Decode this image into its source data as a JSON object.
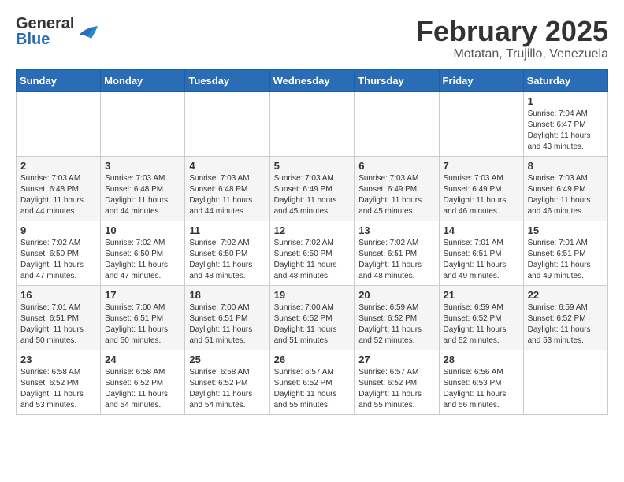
{
  "header": {
    "logo_general": "General",
    "logo_blue": "Blue",
    "month_title": "February 2025",
    "location": "Motatan, Trujillo, Venezuela"
  },
  "weekdays": [
    "Sunday",
    "Monday",
    "Tuesday",
    "Wednesday",
    "Thursday",
    "Friday",
    "Saturday"
  ],
  "weeks": [
    [
      {
        "day": "",
        "info": ""
      },
      {
        "day": "",
        "info": ""
      },
      {
        "day": "",
        "info": ""
      },
      {
        "day": "",
        "info": ""
      },
      {
        "day": "",
        "info": ""
      },
      {
        "day": "",
        "info": ""
      },
      {
        "day": "1",
        "info": "Sunrise: 7:04 AM\nSunset: 6:47 PM\nDaylight: 11 hours and 43 minutes."
      }
    ],
    [
      {
        "day": "2",
        "info": "Sunrise: 7:03 AM\nSunset: 6:48 PM\nDaylight: 11 hours and 44 minutes."
      },
      {
        "day": "3",
        "info": "Sunrise: 7:03 AM\nSunset: 6:48 PM\nDaylight: 11 hours and 44 minutes."
      },
      {
        "day": "4",
        "info": "Sunrise: 7:03 AM\nSunset: 6:48 PM\nDaylight: 11 hours and 44 minutes."
      },
      {
        "day": "5",
        "info": "Sunrise: 7:03 AM\nSunset: 6:49 PM\nDaylight: 11 hours and 45 minutes."
      },
      {
        "day": "6",
        "info": "Sunrise: 7:03 AM\nSunset: 6:49 PM\nDaylight: 11 hours and 45 minutes."
      },
      {
        "day": "7",
        "info": "Sunrise: 7:03 AM\nSunset: 6:49 PM\nDaylight: 11 hours and 46 minutes."
      },
      {
        "day": "8",
        "info": "Sunrise: 7:03 AM\nSunset: 6:49 PM\nDaylight: 11 hours and 46 minutes."
      }
    ],
    [
      {
        "day": "9",
        "info": "Sunrise: 7:02 AM\nSunset: 6:50 PM\nDaylight: 11 hours and 47 minutes."
      },
      {
        "day": "10",
        "info": "Sunrise: 7:02 AM\nSunset: 6:50 PM\nDaylight: 11 hours and 47 minutes."
      },
      {
        "day": "11",
        "info": "Sunrise: 7:02 AM\nSunset: 6:50 PM\nDaylight: 11 hours and 48 minutes."
      },
      {
        "day": "12",
        "info": "Sunrise: 7:02 AM\nSunset: 6:50 PM\nDaylight: 11 hours and 48 minutes."
      },
      {
        "day": "13",
        "info": "Sunrise: 7:02 AM\nSunset: 6:51 PM\nDaylight: 11 hours and 48 minutes."
      },
      {
        "day": "14",
        "info": "Sunrise: 7:01 AM\nSunset: 6:51 PM\nDaylight: 11 hours and 49 minutes."
      },
      {
        "day": "15",
        "info": "Sunrise: 7:01 AM\nSunset: 6:51 PM\nDaylight: 11 hours and 49 minutes."
      }
    ],
    [
      {
        "day": "16",
        "info": "Sunrise: 7:01 AM\nSunset: 6:51 PM\nDaylight: 11 hours and 50 minutes."
      },
      {
        "day": "17",
        "info": "Sunrise: 7:00 AM\nSunset: 6:51 PM\nDaylight: 11 hours and 50 minutes."
      },
      {
        "day": "18",
        "info": "Sunrise: 7:00 AM\nSunset: 6:51 PM\nDaylight: 11 hours and 51 minutes."
      },
      {
        "day": "19",
        "info": "Sunrise: 7:00 AM\nSunset: 6:52 PM\nDaylight: 11 hours and 51 minutes."
      },
      {
        "day": "20",
        "info": "Sunrise: 6:59 AM\nSunset: 6:52 PM\nDaylight: 11 hours and 52 minutes."
      },
      {
        "day": "21",
        "info": "Sunrise: 6:59 AM\nSunset: 6:52 PM\nDaylight: 11 hours and 52 minutes."
      },
      {
        "day": "22",
        "info": "Sunrise: 6:59 AM\nSunset: 6:52 PM\nDaylight: 11 hours and 53 minutes."
      }
    ],
    [
      {
        "day": "23",
        "info": "Sunrise: 6:58 AM\nSunset: 6:52 PM\nDaylight: 11 hours and 53 minutes."
      },
      {
        "day": "24",
        "info": "Sunrise: 6:58 AM\nSunset: 6:52 PM\nDaylight: 11 hours and 54 minutes."
      },
      {
        "day": "25",
        "info": "Sunrise: 6:58 AM\nSunset: 6:52 PM\nDaylight: 11 hours and 54 minutes."
      },
      {
        "day": "26",
        "info": "Sunrise: 6:57 AM\nSunset: 6:52 PM\nDaylight: 11 hours and 55 minutes."
      },
      {
        "day": "27",
        "info": "Sunrise: 6:57 AM\nSunset: 6:52 PM\nDaylight: 11 hours and 55 minutes."
      },
      {
        "day": "28",
        "info": "Sunrise: 6:56 AM\nSunset: 6:53 PM\nDaylight: 11 hours and 56 minutes."
      },
      {
        "day": "",
        "info": ""
      }
    ]
  ]
}
